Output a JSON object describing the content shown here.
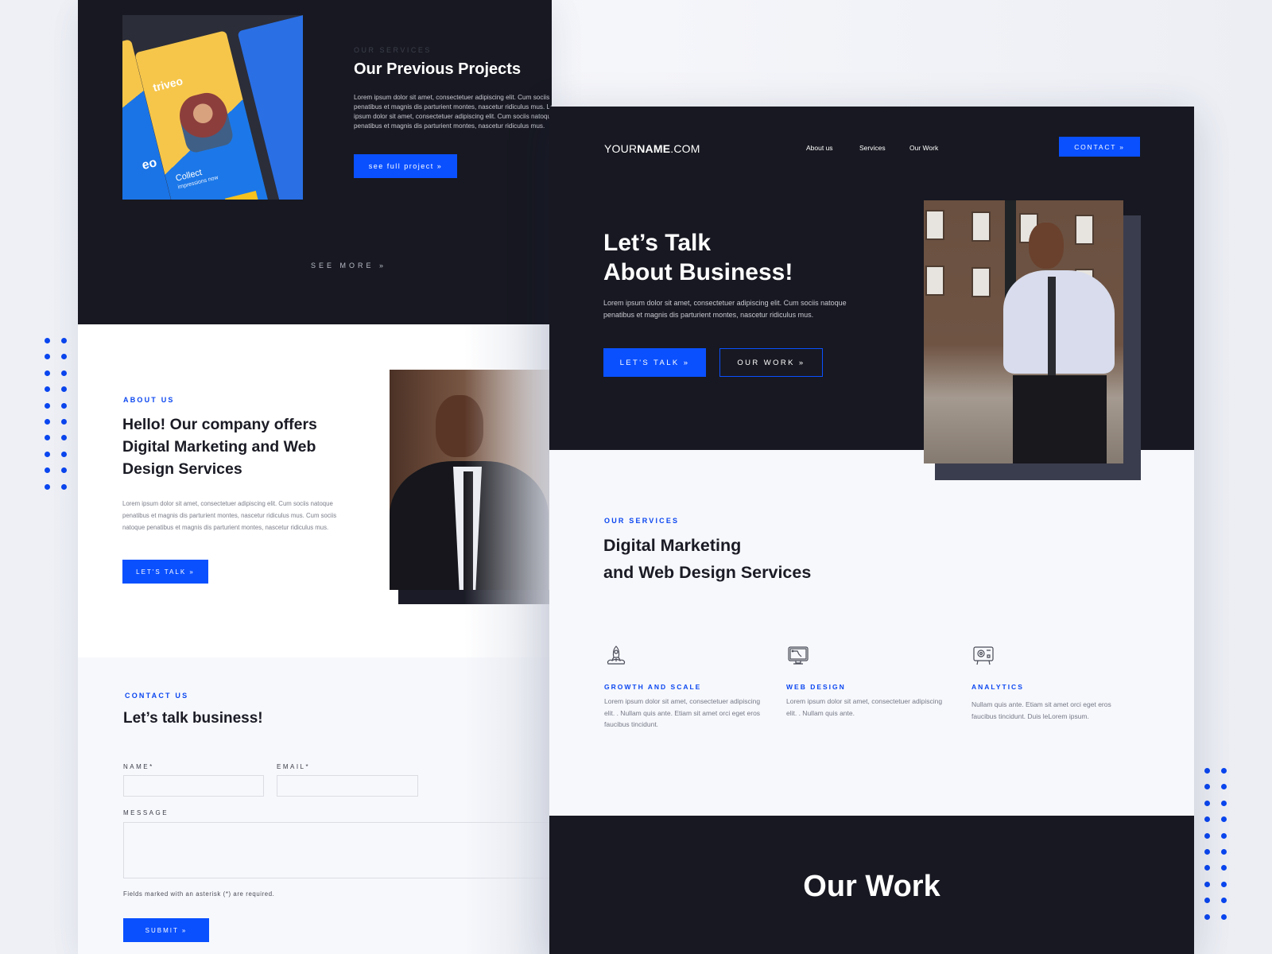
{
  "decor": {
    "dot_color": "#0a46f0",
    "dot_count": 20
  },
  "colors": {
    "accent": "#0a50ff",
    "dark": "#171821",
    "light": "#f7f8fc"
  },
  "left_page": {
    "projects": {
      "kicker": "OUR SERVICES",
      "title": "Our Previous Projects",
      "text": "Lorem ipsum dolor sit amet, consectetuer adipiscing elit. Cum sociis natoque penatibus et magnis dis parturient montes, nascetur ridiculus mus. Lorem ipsum dolor sit amet, consectetuer adipiscing elit. Cum sociis natoque penatibus et magnis dis parturient montes, nascetur ridiculus mus.",
      "button": "see full project »",
      "mockup": {
        "brand": "triveo",
        "brand_partial": "eo",
        "headline": "Collect",
        "subline": "impressions now"
      },
      "see_more": "SEE MORE »"
    },
    "about": {
      "kicker": "ABOUT US",
      "title": "Hello! Our company offers Digital Marketing and Web Design Services",
      "text": "Lorem ipsum dolor sit amet, consectetuer adipiscing elit. Cum sociis natoque penatibus et magnis dis parturient montes, nascetur ridiculus mus. Cum sociis natoque penatibus et magnis dis parturient montes, nascetur ridiculus mus.",
      "button": "LET'S TALK »"
    },
    "contact": {
      "kicker": "CONTACT US",
      "title": "Let’s talk business!",
      "name_label": "NAME*",
      "email_label": "EMAIL*",
      "message_label": "MESSAGE",
      "name_value": "",
      "email_value": "",
      "message_value": "",
      "required_note": "Fields marked with an asterisk (*) are required.",
      "submit": "SUBMIT »"
    }
  },
  "right_page": {
    "header": {
      "logo_prefix": "YOUR",
      "logo_bold": "NAME",
      "logo_suffix": ".COM",
      "nav": [
        {
          "label": "About us"
        },
        {
          "label": "Services"
        },
        {
          "label": "Our Work"
        }
      ],
      "contact_button": "CONTACT »"
    },
    "hero": {
      "title_line1": "Let’s Talk",
      "title_line2": "About Business!",
      "text": "Lorem ipsum dolor sit amet, consectetuer adipiscing elit. Cum sociis natoque penatibus et magnis dis parturient montes, nascetur ridiculus mus.",
      "primary_button": "LET'S TALK »",
      "secondary_button": "OUR WORK »"
    },
    "services": {
      "kicker": "OUR SERVICES",
      "title_line1": "Digital Marketing",
      "title_line2": "and Web Design Services",
      "items": [
        {
          "icon": "rocket-icon",
          "title": "GROWTH AND SCALE",
          "text": "Lorem ipsum dolor sit amet, consectetuer adipiscing elit. . Nullam quis ante. Etiam sit amet orci eget eros faucibus tincidunt."
        },
        {
          "icon": "monitor-design-icon",
          "title": "WEB DESIGN",
          "text": "Lorem ipsum dolor sit amet, consectetuer adipiscing elit. . Nullam quis ante."
        },
        {
          "icon": "analytics-board-icon",
          "title": "ANALYTICS",
          "text": "Nullam quis ante. Etiam sit amet orci eget eros faucibus tincidunt. Duis leLorem ipsum."
        }
      ]
    },
    "work": {
      "title": "Our Work"
    }
  }
}
